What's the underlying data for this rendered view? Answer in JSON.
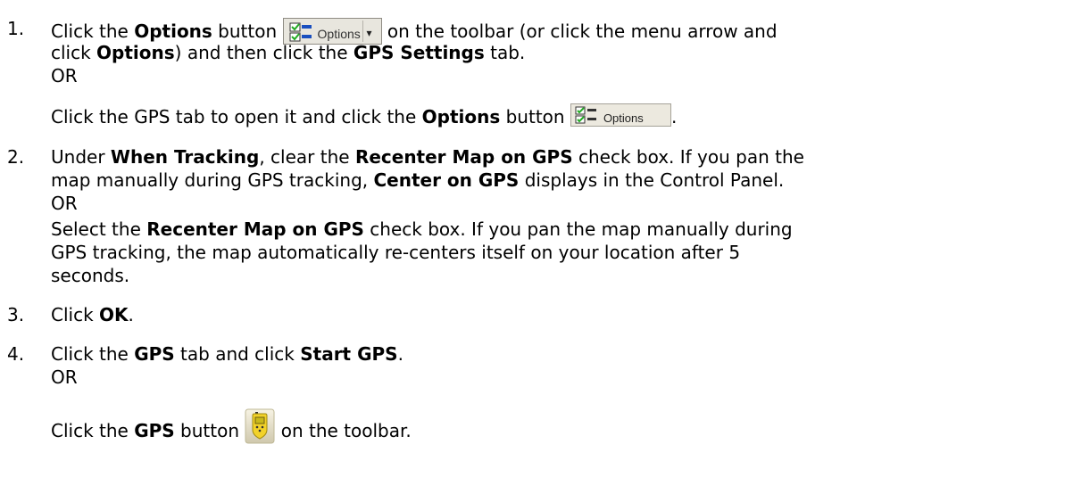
{
  "step1": {
    "number": "1.",
    "l1_a": "Click the ",
    "l1_b": "Options",
    "l1_c": " button ",
    "l1_d": " on the toolbar (or click the menu arrow and",
    "l2_a": "click ",
    "l2_b": "Options",
    "l2_c": ") and then click the ",
    "l2_d": "GPS Settings",
    "l2_e": " tab.",
    "or": "OR",
    "l4_a": "Click the GPS tab to open it and click the ",
    "l4_b": "Options",
    "l4_c": " button ",
    "l4_d": ".",
    "options_button_label": "Options",
    "options_button2_label": "Options"
  },
  "step2": {
    "number": "2.",
    "l1_a": "Under ",
    "l1_b": "When Tracking",
    "l1_c": ", clear the ",
    "l1_d": "Recenter Map on GPS",
    "l1_e": " check box. If you pan the",
    "l2_a": "map manually during GPS tracking, ",
    "l2_b": "Center on GPS",
    "l2_c": " displays in the Control Panel.",
    "or": "OR",
    "l4_a": "Select the ",
    "l4_b": "Recenter Map on GPS",
    "l4_c": " check box. If you pan the map manually during",
    "l5": "GPS tracking, the map automatically re-centers itself on your location after 5",
    "l6": "seconds."
  },
  "step3": {
    "number": "3.",
    "a": "Click ",
    "b": "OK",
    "c": "."
  },
  "step4": {
    "number": "4.",
    "l1_a": "Click the ",
    "l1_b": "GPS",
    "l1_c": " tab and click ",
    "l1_d": "Start GPS",
    "l1_e": ".",
    "or": "OR",
    "l3_a": "Click the ",
    "l3_b": "GPS",
    "l3_c": " button ",
    "l3_d": " on the toolbar."
  }
}
